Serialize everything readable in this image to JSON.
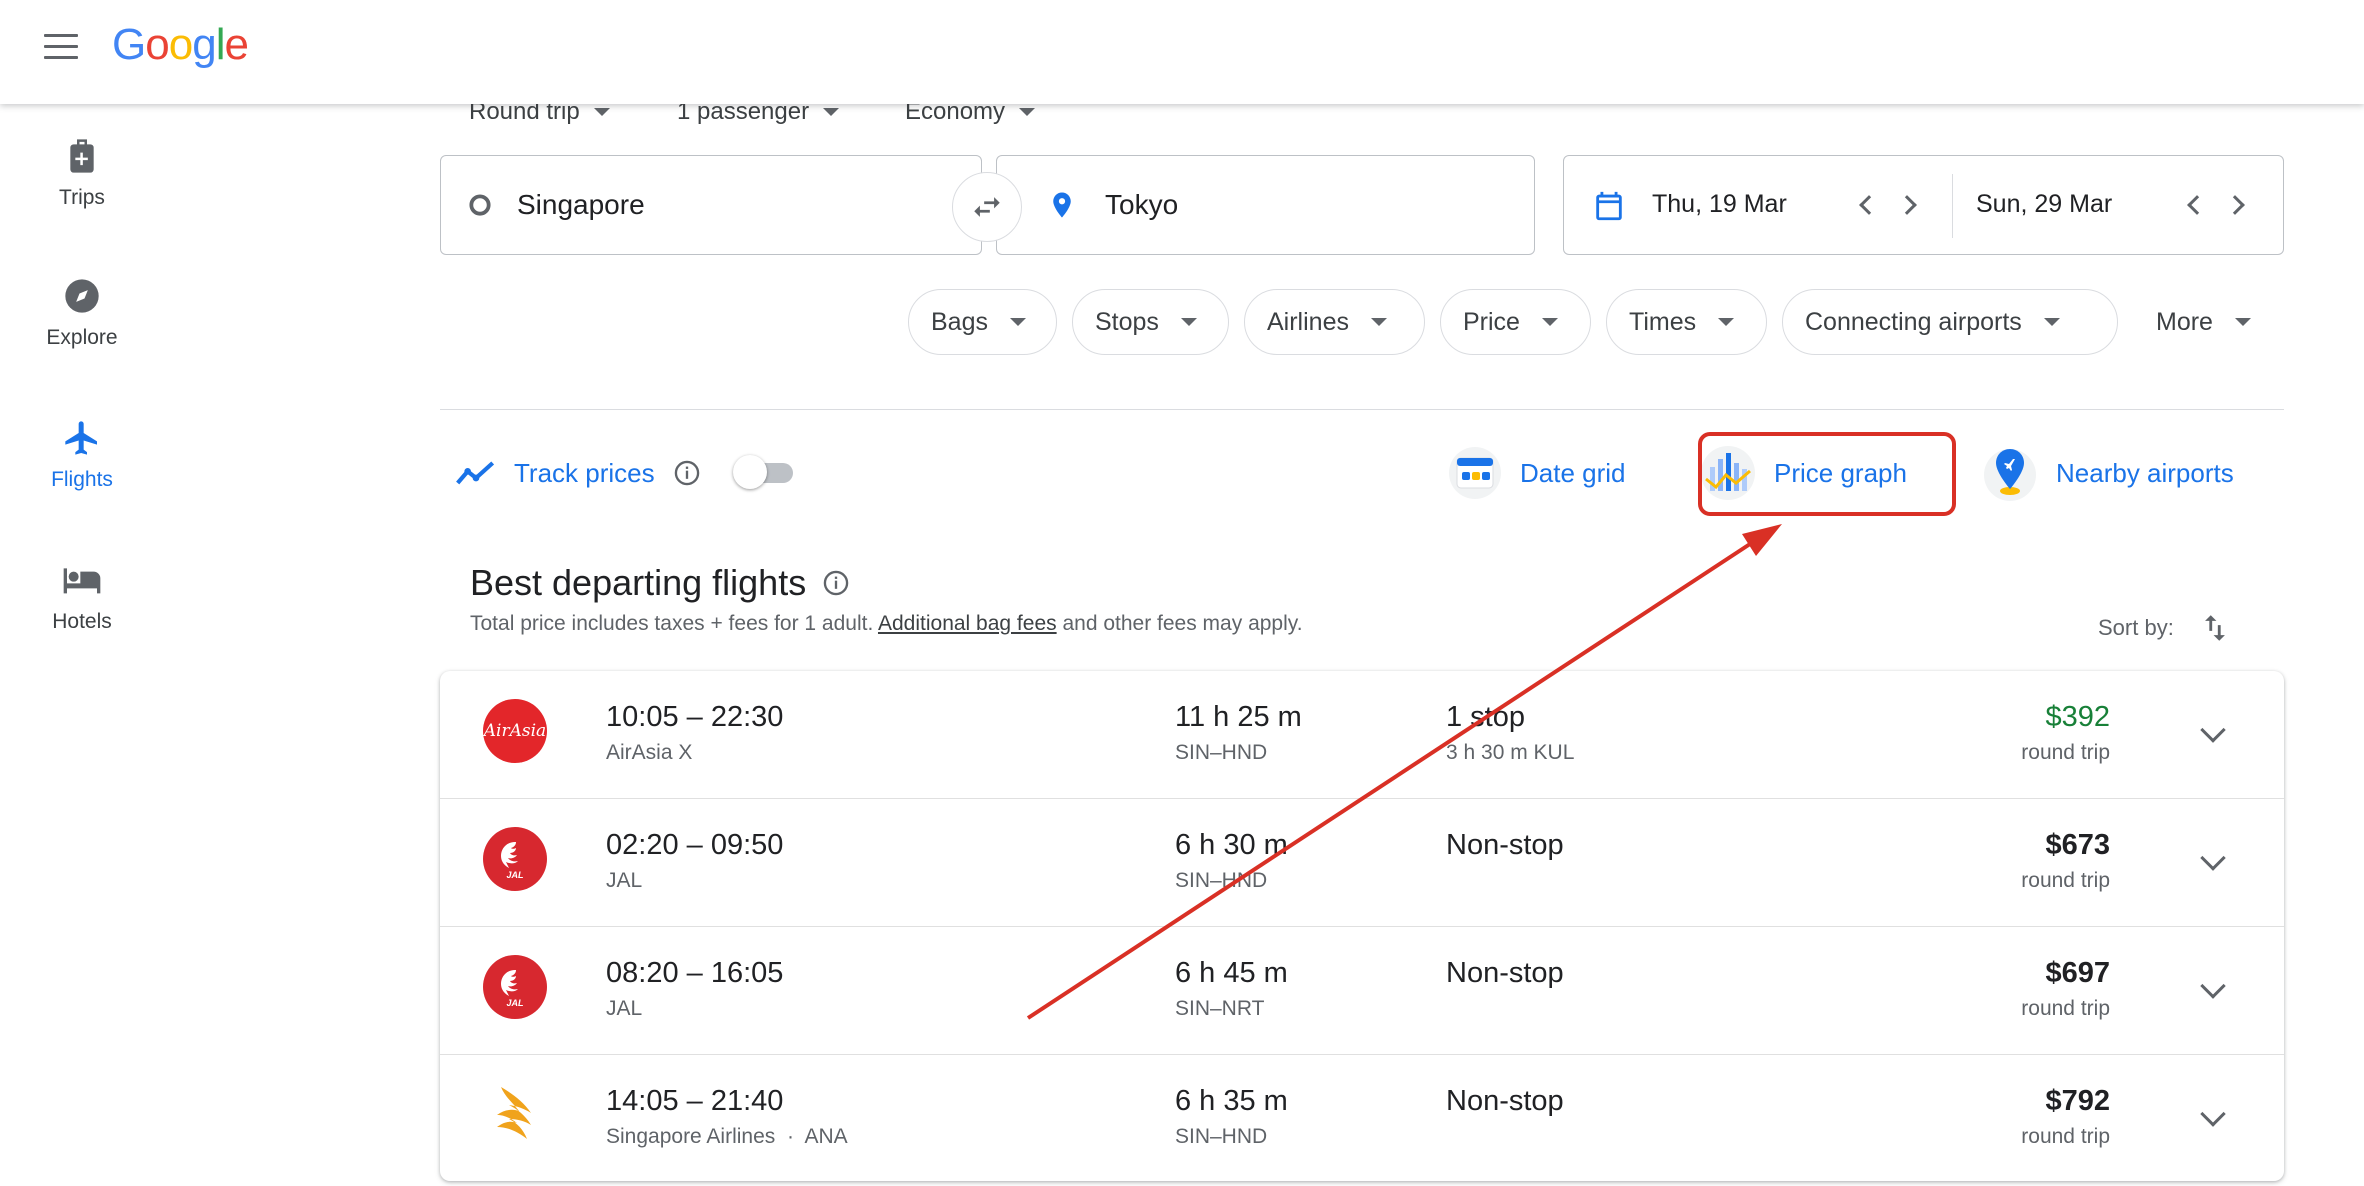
{
  "header": {
    "logo_text": "Google"
  },
  "sidebar": {
    "items": [
      {
        "label": "Trips",
        "icon": "luggage-icon"
      },
      {
        "label": "Explore",
        "icon": "compass-icon"
      },
      {
        "label": "Flights",
        "icon": "airplane-icon"
      },
      {
        "label": "Hotels",
        "icon": "bed-icon"
      }
    ],
    "active": "Flights"
  },
  "search": {
    "trip_type": "Round trip",
    "passengers": "1 passenger",
    "cabin": "Economy",
    "origin": "Singapore",
    "destination": "Tokyo",
    "depart_date": "Thu, 19 Mar",
    "return_date": "Sun, 29 Mar"
  },
  "filters": [
    "Bags",
    "Stops",
    "Airlines",
    "Price",
    "Times",
    "Connecting airports",
    "More"
  ],
  "tools": {
    "track_prices": "Track prices",
    "track_enabled": false,
    "date_grid": "Date grid",
    "price_graph": "Price graph",
    "nearby_airports": "Nearby airports"
  },
  "results": {
    "title": "Best departing flights",
    "subtext_before": "Total price includes taxes + fees for 1 adult. ",
    "subtext_link": "Additional bag fees",
    "subtext_after": " and other fees may apply.",
    "sort_label": "Sort by:",
    "flights": [
      {
        "times": "10:05 – 22:30",
        "airline": "AirAsia X",
        "duration": "11 h 25 m",
        "route": "SIN–HND",
        "stops": "1 stop",
        "layover": "3 h 30 m KUL",
        "price": "$392",
        "price_note": "round trip",
        "cheapest": true,
        "logo": "airasia-logo"
      },
      {
        "times": "02:20 – 09:50",
        "airline": "JAL",
        "duration": "6 h 30 m",
        "route": "SIN–HND",
        "stops": "Non-stop",
        "layover": "",
        "price": "$673",
        "price_note": "round trip",
        "cheapest": false,
        "logo": "jal-logo"
      },
      {
        "times": "08:20 – 16:05",
        "airline": "JAL",
        "duration": "6 h 45 m",
        "route": "SIN–NRT",
        "stops": "Non-stop",
        "layover": "",
        "price": "$697",
        "price_note": "round trip",
        "cheapest": false,
        "logo": "jal-logo"
      },
      {
        "times": "14:05 – 21:40",
        "airline": "Singapore Airlines  ·  ANA",
        "duration": "6 h 35 m",
        "route": "SIN–HND",
        "stops": "Non-stop",
        "layover": "",
        "price": "$792",
        "price_note": "round trip",
        "cheapest": false,
        "logo": "singapore-airlines-logo"
      }
    ]
  },
  "colors": {
    "accent": "#1a73e8",
    "cheap_price": "#188038",
    "annotation": "#d93025",
    "airasia": "#e3262a",
    "jal": "#d7282f",
    "singapore": "#f0a31c"
  }
}
